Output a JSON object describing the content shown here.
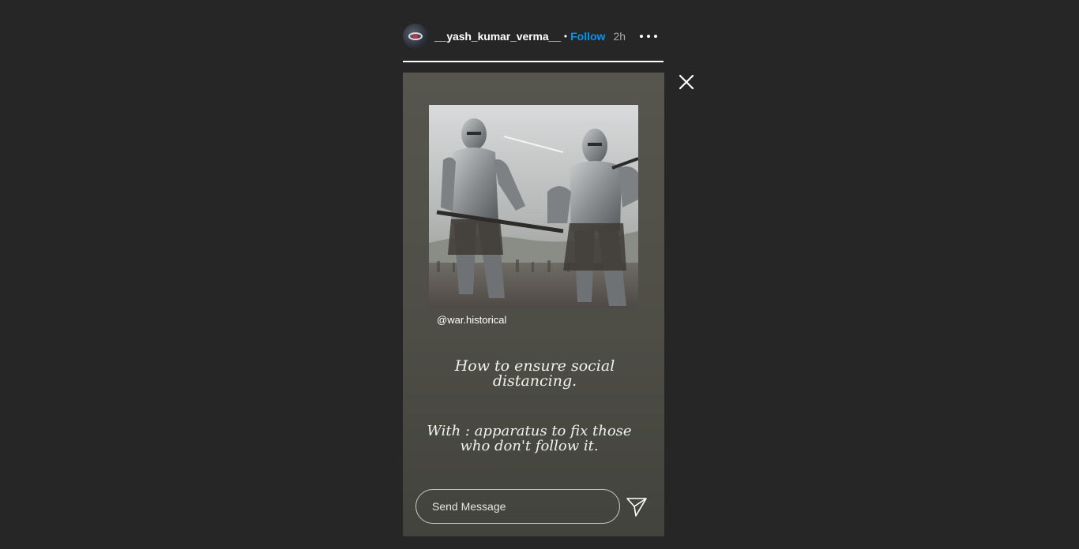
{
  "header": {
    "username": "__yash_kumar_verma__",
    "separator": "•",
    "follow_label": "Follow",
    "time_ago": "2h",
    "more_icon": "more-horizontal-icon"
  },
  "progress": {
    "value": 1.0
  },
  "story": {
    "photo_handle": "@war.historical",
    "caption_line_1": "How to ensure social distancing.",
    "caption_line_2": "With : apparatus to fix those who don't follow it."
  },
  "reply": {
    "placeholder": "Send Message",
    "send_icon": "send-icon"
  },
  "close_icon": "close-icon",
  "colors": {
    "background": "#262626",
    "accent": "#0095f6",
    "story_bg": "#4e4e47"
  }
}
